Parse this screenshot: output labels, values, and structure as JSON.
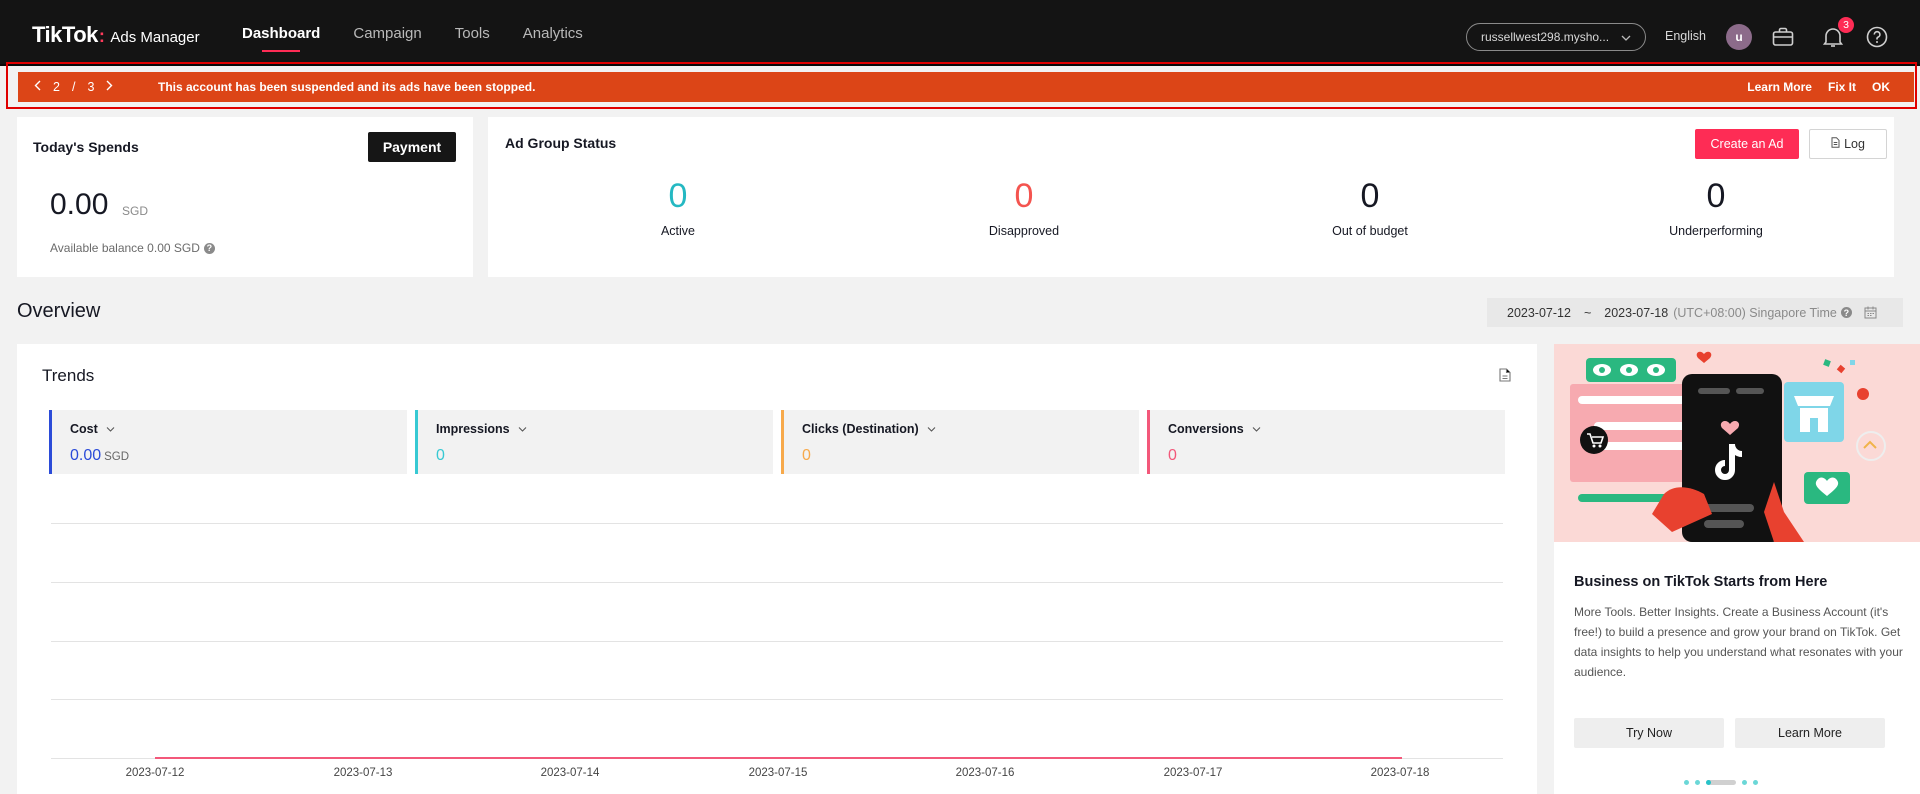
{
  "header": {
    "logo_main": "TikTok",
    "logo_colon": ":",
    "logo_sub": "Ads Manager",
    "nav": [
      {
        "label": "Dashboard",
        "active": true
      },
      {
        "label": "Campaign",
        "active": false
      },
      {
        "label": "Tools",
        "active": false
      },
      {
        "label": "Analytics",
        "active": false
      }
    ],
    "account": "russellwest298.mysho...",
    "language": "English",
    "avatar_initial": "u",
    "notification_count": "3",
    "icons": [
      "briefcase-icon",
      "bell-icon",
      "help-icon"
    ]
  },
  "alert": {
    "page_current": "2",
    "page_sep": "/",
    "page_total": "3",
    "message": "This account has been suspended and its ads have been stopped.",
    "learn_more": "Learn More",
    "fix_it": "Fix It",
    "ok": "OK",
    "color": "#dc4517"
  },
  "spends": {
    "title": "Today's Spends",
    "payment_label": "Payment",
    "amount": "0.00",
    "currency": "SGD",
    "balance": "Available balance 0.00 SGD"
  },
  "ad_group": {
    "title": "Ad Group Status",
    "create_label": "Create an Ad",
    "log_label": "Log",
    "stats": [
      {
        "value": "0",
        "label": "Active",
        "color": "#24b8c2"
      },
      {
        "value": "0",
        "label": "Disapproved",
        "color": "#f4544f"
      },
      {
        "value": "0",
        "label": "Out of budget",
        "color": "#161823"
      },
      {
        "value": "0",
        "label": "Underperforming",
        "color": "#161823"
      }
    ]
  },
  "overview": {
    "title": "Overview",
    "date_start": "2023-07-12",
    "date_sep": "~",
    "date_end": "2023-07-18",
    "timezone": "(UTC+08:00) Singapore Time"
  },
  "trends": {
    "title": "Trends",
    "metrics": [
      {
        "name": "Cost",
        "value": "0.00",
        "unit": "SGD",
        "color": "#2b4bd8"
      },
      {
        "name": "Impressions",
        "value": "0",
        "unit": "",
        "color": "#37c9d3"
      },
      {
        "name": "Clicks (Destination)",
        "value": "0",
        "unit": "",
        "color": "#f7a94b"
      },
      {
        "name": "Conversions",
        "value": "0",
        "unit": "",
        "color": "#f3587a"
      }
    ],
    "x_labels": [
      "2023-07-12",
      "2023-07-13",
      "2023-07-14",
      "2023-07-15",
      "2023-07-16",
      "2023-07-17",
      "2023-07-18"
    ]
  },
  "promo": {
    "title": "Business on TikTok Starts from Here",
    "text": "More Tools. Better Insights. Create a Business Account (it's free!) to build a presence and grow your brand on TikTok. Get data insights to help you understand what resonates with your audience.",
    "try_now": "Try Now",
    "learn_more": "Learn More"
  }
}
